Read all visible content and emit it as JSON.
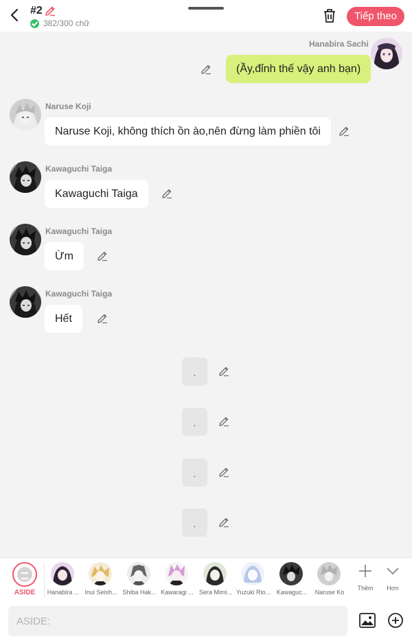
{
  "header": {
    "episode": "#2",
    "word_count": "382/300 chữ",
    "next_label": "Tiếp theo",
    "accent_color": "#f0566b"
  },
  "messages": [
    {
      "sender": "Hanabira Sachi",
      "text": "(Ầy,đỉnh thế vậy anh bạn)",
      "mine": true
    },
    {
      "sender": "Naruse Koji",
      "text": "Naruse Koji, không thích ồn ào,nên đừng làm phiền tôi",
      "mine": false
    },
    {
      "sender": "Kawaguchi Taiga",
      "text": "Kawaguchi Taiga",
      "mine": false
    },
    {
      "sender": "Kawaguchi Taiga",
      "text": "Ừm",
      "mine": false
    },
    {
      "sender": "Kawaguchi Taiga",
      "text": "Hết",
      "mine": false
    }
  ],
  "aside_messages": [
    ".",
    ".",
    ".",
    "."
  ],
  "characters": {
    "aside_label": "ASIDE",
    "items": [
      "Hanabira ...",
      "Inui Seish...",
      "Shiba Hak...",
      "Kawaragi ...",
      "Sera Mimi...",
      "Yuzuki Rio...",
      "Kawaguc...",
      "Naruse Ko"
    ],
    "add_label": "Thêm",
    "more_label": "Hơn"
  },
  "input": {
    "placeholder": "ASIDE:"
  }
}
